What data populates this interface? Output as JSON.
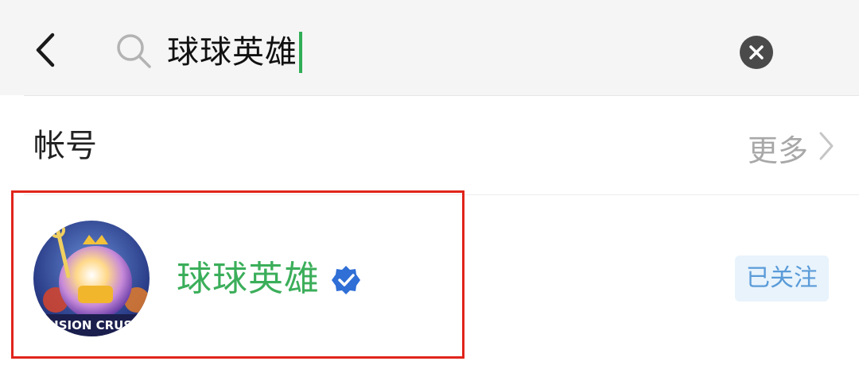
{
  "search": {
    "query": "球球英雄"
  },
  "section": {
    "title": "帐号",
    "more_label": "更多"
  },
  "account": {
    "name": "球球英雄",
    "avatar_text": "FUSION CRUSH",
    "follow_label": "已关注",
    "verified": true
  },
  "colors": {
    "accent_green": "#3bae5a",
    "caret_green": "#2fae55",
    "verified_blue": "#2f6fd6",
    "highlight_red": "#e0241b",
    "follow_text": "#5a9bd8",
    "follow_bg": "#e8f3fc"
  },
  "icons": [
    "back-chevron-icon",
    "search-icon",
    "clear-icon",
    "chevron-right-icon",
    "verified-badge-icon"
  ]
}
